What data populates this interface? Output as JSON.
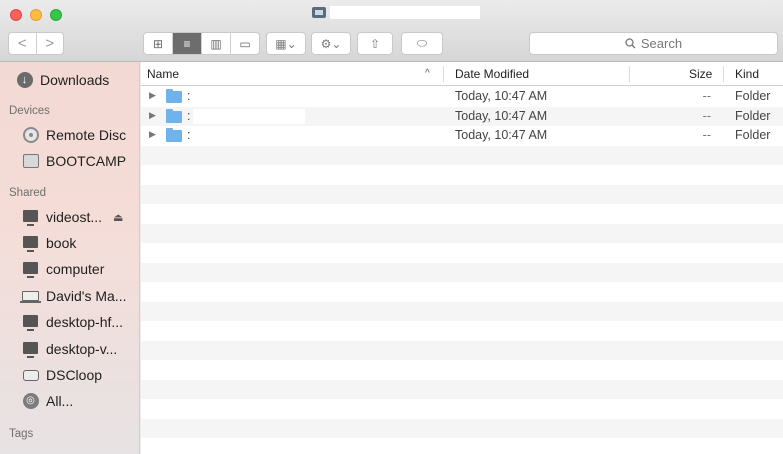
{
  "window": {
    "title": ""
  },
  "toolbar": {
    "back_label": "<",
    "forward_label": ">",
    "view_icons": "⊞",
    "view_list": "≡",
    "view_columns": "▥",
    "view_coverflow": "▭",
    "arrange_label": "▦⌄",
    "action_label": "⚙⌄",
    "share_label": "⇧",
    "tag_label": "⬭",
    "search_placeholder": "Search"
  },
  "sidebar": {
    "favorites": [
      {
        "label": "Downloads",
        "icon": "download-icon"
      }
    ],
    "devices_title": "Devices",
    "devices": [
      {
        "label": "Remote Disc",
        "icon": "disc-icon"
      },
      {
        "label": "BOOTCAMP",
        "icon": "drive-icon"
      }
    ],
    "shared_title": "Shared",
    "shared": [
      {
        "label": "videost...",
        "icon": "monitor-icon",
        "eject": "⏏"
      },
      {
        "label": "book",
        "icon": "monitor-icon"
      },
      {
        "label": "computer",
        "icon": "monitor-icon"
      },
      {
        "label": "David's Ma...",
        "icon": "laptop-icon"
      },
      {
        "label": "desktop-hf...",
        "icon": "monitor-icon"
      },
      {
        "label": "desktop-v...",
        "icon": "monitor-icon"
      },
      {
        "label": "DSCloop",
        "icon": "time-capsule-icon"
      },
      {
        "label": "All...",
        "icon": "globe-icon"
      }
    ],
    "tags_title": "Tags"
  },
  "list": {
    "columns": {
      "name": "Name",
      "date": "Date Modified",
      "size": "Size",
      "kind": "Kind"
    },
    "sort_indicator": "^",
    "rows": [
      {
        "name": ":",
        "date": "Today, 10:47 AM",
        "size": "--",
        "kind": "Folder"
      },
      {
        "name": ":",
        "date": "Today, 10:47 AM",
        "size": "--",
        "kind": "Folder"
      },
      {
        "name": ":",
        "date": "Today, 10:47 AM",
        "size": "--",
        "kind": "Folder"
      }
    ]
  }
}
